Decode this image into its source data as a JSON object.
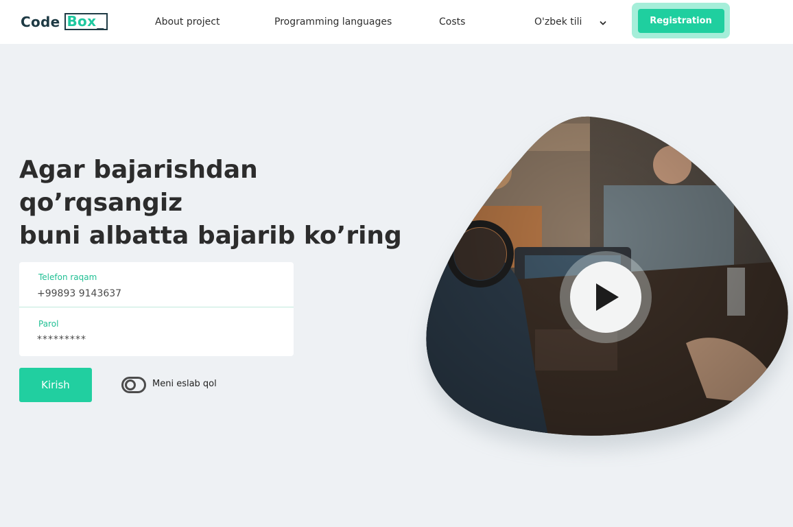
{
  "header": {
    "logo": {
      "code": "Code",
      "box": "Box",
      "cursor": "_"
    },
    "nav": [
      {
        "label": "About project"
      },
      {
        "label": "Programming languages"
      },
      {
        "label": "Costs"
      }
    ],
    "language": {
      "selected": "O'zbek tili",
      "icon": "chevron-down-icon"
    },
    "registration_label": "Registration"
  },
  "hero": {
    "title_line1": "Agar bajarishdan qo’rqsangiz",
    "title_line2": "buni albatta bajarib ko’ring"
  },
  "form": {
    "phone": {
      "label": "Telefon raqam",
      "value": "+99893 9143637"
    },
    "password": {
      "label": "Parol",
      "value": "*********"
    },
    "submit_label": "Kirish",
    "remember_label": "Meni eslab qol",
    "remember_on": false
  },
  "media": {
    "play_icon": "play-icon"
  },
  "colors": {
    "accent": "#21cfa0",
    "accent_light": "#a5eed9",
    "background": "#eef1f4",
    "dark": "#1e3a44"
  }
}
